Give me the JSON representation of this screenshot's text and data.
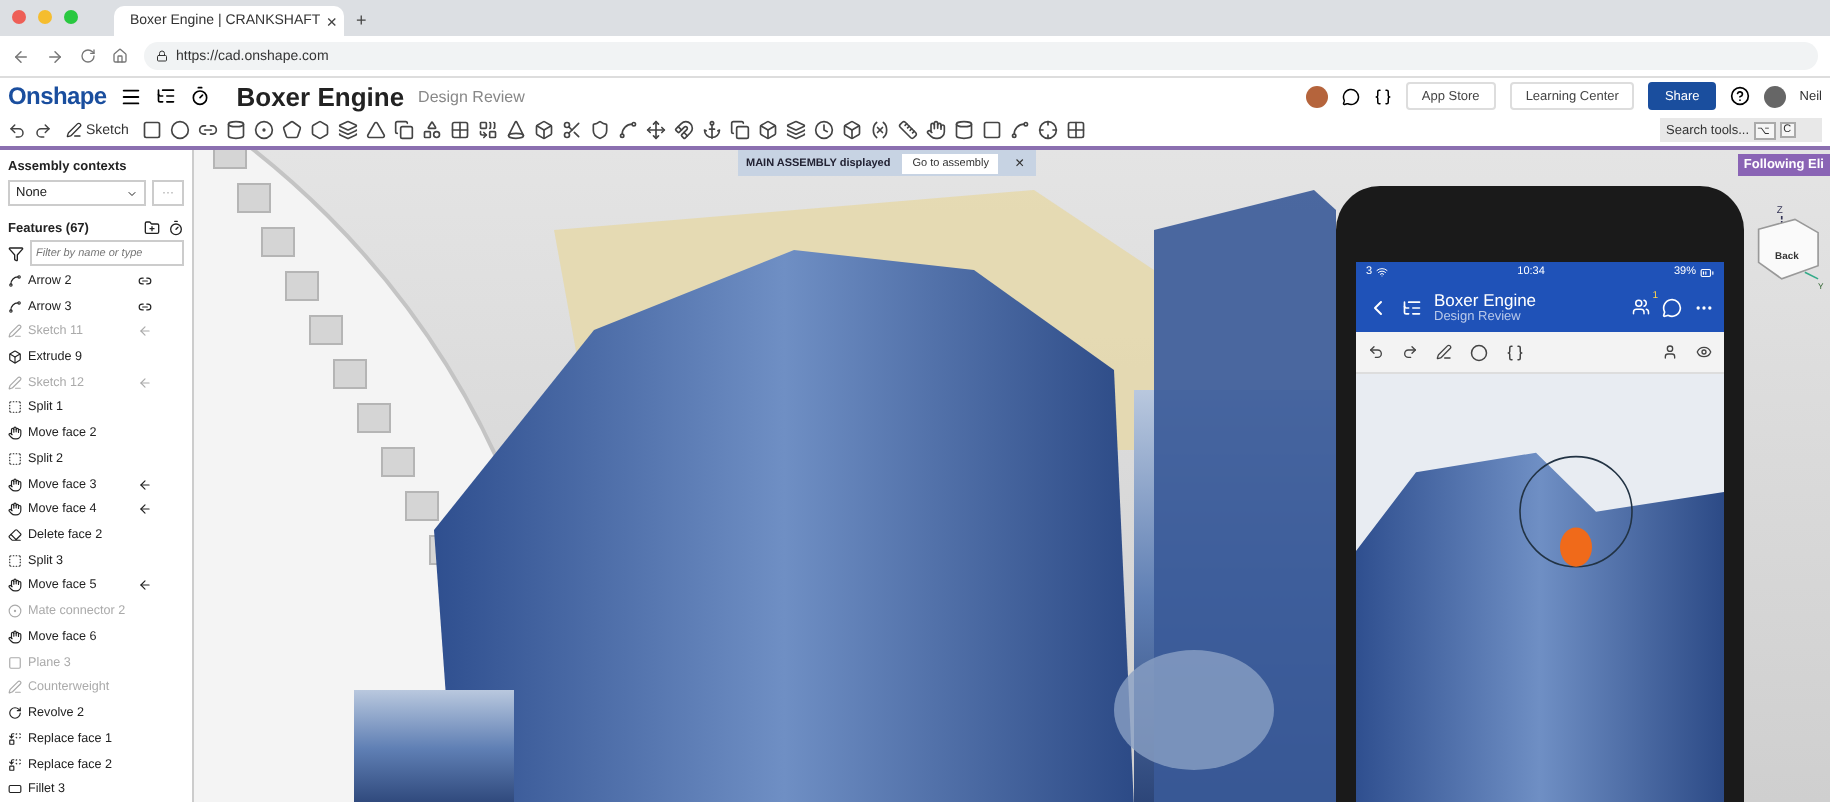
{
  "browser": {
    "tab_title": "Boxer Engine | CRANKSHAFT",
    "tab_close": "×",
    "new_tab": "+",
    "url": "https://cad.onshape.com"
  },
  "app_header": {
    "logo": "Onshape",
    "document": "Boxer Engine",
    "workspace": "Design Review",
    "user": "Neil",
    "buttons": [
      {
        "label": "App Store",
        "kind": "plain"
      },
      {
        "label": "Learning Center",
        "kind": "plain"
      },
      {
        "label": "Share",
        "kind": "primary"
      }
    ]
  },
  "toolbar": {
    "sketch": "Sketch",
    "search": "Search tools...",
    "shortcut": [
      "⌥",
      "C"
    ]
  },
  "sidebar": {
    "contexts_label": "Assembly contexts",
    "context_value": "None",
    "more": "···",
    "features_title": "Features (67)",
    "filter_placeholder": "Filter by name or type",
    "features": [
      {
        "name": "Arrow 2",
        "kind": "arrow",
        "linked": true,
        "rollback_marker": false,
        "disabled": false
      },
      {
        "name": "Arrow 3",
        "kind": "arrow",
        "linked": true,
        "rollback_marker": false,
        "disabled": false
      },
      {
        "name": "Sketch 11",
        "kind": "sketch",
        "linked": false,
        "rollback_marker": true,
        "disabled": true
      },
      {
        "name": "Extrude 9",
        "kind": "extrude",
        "linked": false,
        "rollback_marker": false,
        "disabled": false
      },
      {
        "name": "Sketch 12",
        "kind": "sketch",
        "linked": false,
        "rollback_marker": true,
        "disabled": true
      },
      {
        "name": "Split 1",
        "kind": "split",
        "linked": false,
        "rollback_marker": false,
        "disabled": false
      },
      {
        "name": "Move face 2",
        "kind": "move",
        "linked": false,
        "rollback_marker": false,
        "disabled": false
      },
      {
        "name": "Split 2",
        "kind": "split",
        "linked": false,
        "rollback_marker": false,
        "disabled": false
      },
      {
        "name": "Move face 3",
        "kind": "move",
        "linked": false,
        "rollback_marker": true,
        "disabled": false
      },
      {
        "name": "Move face 4",
        "kind": "move",
        "linked": false,
        "rollback_marker": true,
        "disabled": false
      },
      {
        "name": "Delete face 2",
        "kind": "delete",
        "linked": false,
        "rollback_marker": false,
        "disabled": false
      },
      {
        "name": "Split 3",
        "kind": "split",
        "linked": false,
        "rollback_marker": false,
        "disabled": false
      },
      {
        "name": "Move face 5",
        "kind": "move",
        "linked": false,
        "rollback_marker": true,
        "disabled": false
      },
      {
        "name": "Mate connector 2",
        "kind": "mate",
        "linked": false,
        "rollback_marker": false,
        "disabled": true
      },
      {
        "name": "Move face 6",
        "kind": "move",
        "linked": false,
        "rollback_marker": false,
        "disabled": false
      },
      {
        "name": "Plane 3",
        "kind": "plane",
        "linked": false,
        "rollback_marker": false,
        "disabled": true
      },
      {
        "name": "Counterweight",
        "kind": "sketch",
        "linked": false,
        "rollback_marker": false,
        "disabled": true
      },
      {
        "name": "Revolve 2",
        "kind": "revolve",
        "linked": false,
        "rollback_marker": false,
        "disabled": false
      },
      {
        "name": "Replace face 1",
        "kind": "replace",
        "linked": false,
        "rollback_marker": false,
        "disabled": false
      },
      {
        "name": "Replace face 2",
        "kind": "replace",
        "linked": false,
        "rollback_marker": false,
        "disabled": false
      },
      {
        "name": "Fillet 3",
        "kind": "fillet",
        "linked": false,
        "rollback_marker": false,
        "disabled": false
      }
    ]
  },
  "viewport": {
    "notice": "MAIN ASSEMBLY displayed",
    "notice_action": "Go to assembly",
    "notice_close": "×",
    "following": "Following Eli",
    "view_cube": {
      "face": "Back",
      "axes": [
        "Z",
        "Y"
      ]
    }
  },
  "phone": {
    "carrier": "3",
    "time": "10:34",
    "battery": "39%",
    "title": "Boxer Engine",
    "subtitle": "Design Review",
    "badge": "1"
  }
}
